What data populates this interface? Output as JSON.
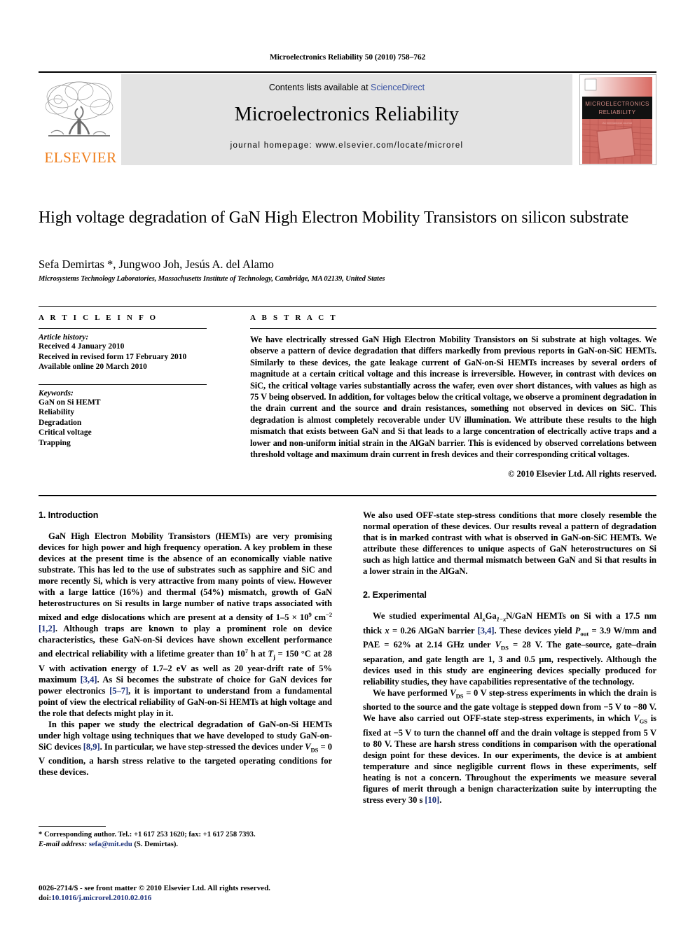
{
  "running_head": "Microelectronics Reliability 50 (2010) 758–762",
  "masthead": {
    "contents_prefix": "Contents lists available at ",
    "sciencedirect": "ScienceDirect",
    "journal_name": "Microelectronics Reliability",
    "homepage": "journal homepage: www.elsevier.com/locate/microrel",
    "publisher_wordmark": "ELSEVIER",
    "cover_title_line1": "MICROELECTRONICS",
    "cover_title_line2": "RELIABILITY",
    "link_color": "#3a53a4",
    "elsevier_orange": "#ef7d1a"
  },
  "article": {
    "title": "High voltage degradation of GaN High Electron Mobility Transistors on silicon substrate",
    "authors": "Sefa Demirtas *, Jungwoo Joh, Jesús A. del Alamo",
    "affiliation": "Microsystems Technology Laboratories, Massachusetts Institute of Technology, Cambridge, MA 02139, United States"
  },
  "article_info": {
    "heading": "A R T I C L E   I N F O",
    "history_label": "Article history:",
    "history": [
      "Received 4 January 2010",
      "Received in revised form 17 February 2010",
      "Available online 20 March 2010"
    ],
    "keywords_label": "Keywords:",
    "keywords": [
      "GaN on Si HEMT",
      "Reliability",
      "Degradation",
      "Critical voltage",
      "Trapping"
    ]
  },
  "abstract": {
    "heading": "A B S T R A C T",
    "text": "We have electrically stressed GaN High Electron Mobility Transistors on Si substrate at high voltages. We observe a pattern of device degradation that differs markedly from previous reports in GaN-on-SiC HEMTs. Similarly to these devices, the gate leakage current of GaN-on-Si HEMTs increases by several orders of magnitude at a certain critical voltage and this increase is irreversible. However, in contrast with devices on SiC, the critical voltage varies substantially across the wafer, even over short distances, with values as high as 75 V being observed. In addition, for voltages below the critical voltage, we observe a prominent degradation in the drain current and the source and drain resistances, something not observed in devices on SiC. This degradation is almost completely recoverable under UV illumination. We attribute these results to the high mismatch that exists between GaN and Si that leads to a large concentration of electrically active traps and a lower and non-uniform initial strain in the AlGaN barrier. This is evidenced by observed correlations between threshold voltage and maximum drain current in fresh devices and their corresponding critical voltages.",
    "copyright": "© 2010 Elsevier Ltd. All rights reserved."
  },
  "sections": {
    "introduction_heading": "1. Introduction",
    "experimental_heading": "2. Experimental"
  },
  "body": {
    "intro_p1_a": "GaN High Electron Mobility Transistors (HEMTs) are very promising devices for high power and high frequency operation. A key problem in these devices at the present time is the absence of an economically viable native substrate. This has led to the use of substrates such as sapphire and SiC and more recently Si, which is very attractive from many points of view. However with a large lattice (16%) and thermal (54%) mismatch, growth of GaN heterostructures on Si results in large number of native traps associated with mixed and edge dislocations which are present at a density of 1–5 × 10",
    "intro_p1_exp1": "9",
    "intro_p1_b": " cm",
    "intro_p1_exp2": "−2",
    "intro_p1_ref1": "[1,2]",
    "intro_p1_c": ". Although traps are known to play a prominent role on device characteristics, these GaN-on-Si devices have shown excellent performance and electrical reliability with a lifetime greater than 10",
    "intro_p1_exp3": "7",
    "intro_p1_d": " h at ",
    "intro_p1_tj": "T",
    "intro_p1_tj_sub": "j",
    "intro_p1_e": " = 150 °C at 28 V with activation energy of 1.7–2 eV as well as 20 year-drift rate of 5% maximum ",
    "intro_p1_ref2": "[3,4]",
    "intro_p1_f": ". As Si becomes the substrate of choice for GaN devices for power electronics ",
    "intro_p1_ref3": "[5–7]",
    "intro_p1_g": ", it is important to understand from a fundamental point of view the electrical reliability of GaN-on-Si HEMTs at high voltage and the role that defects might play in it.",
    "intro_p2_a": "In this paper we study the electrical degradation of GaN-on-Si HEMTs under high voltage using techniques that we have developed to study GaN-on-SiC devices ",
    "intro_p2_ref1": "[8,9]",
    "intro_p2_b": ". In particular, we have step-stressed the devices under ",
    "intro_p2_v": "V",
    "intro_p2_v_sub": "DS",
    "intro_p2_c": " = 0 V condition, a harsh stress relative to the targeted operating conditions for these devices.",
    "right_p1": "We also used OFF-state step-stress conditions that more closely resemble the normal operation of these devices. Our results reveal a pattern of degradation that is in marked contrast with what is observed in GaN-on-SiC HEMTs. We attribute these differences to unique aspects of GaN heterostructures on Si such as high lattice and thermal mismatch between GaN and Si that results in a lower strain in the AlGaN.",
    "exp_p1_a": "We studied experimental Al",
    "exp_p1_sub1": "x",
    "exp_p1_b": "Ga",
    "exp_p1_sub2": "1−x",
    "exp_p1_c": "N/GaN HEMTs on Si with a 17.5 nm thick ",
    "exp_p1_x": "x",
    "exp_p1_d": " = 0.26 AlGaN barrier ",
    "exp_p1_ref1": "[3,4]",
    "exp_p1_e": ". These devices yield ",
    "exp_p1_pout": "P",
    "exp_p1_pout_sub": "out",
    "exp_p1_f": " = 3.9 W/mm and PAE = 62% at 2.14 GHz under ",
    "exp_p1_vds": "V",
    "exp_p1_vds_sub": "DS",
    "exp_p1_g": " = 28 V. The gate–source, gate–drain separation, and gate length are 1, 3 and 0.5 μm, respectively. Although the devices used in this study are engineering devices specially produced for reliability studies, they have capabilities representative of the technology.",
    "exp_p2_a": "We have performed ",
    "exp_p2_vds": "V",
    "exp_p2_vds_sub": "DS",
    "exp_p2_b": " = 0 V step-stress experiments in which the drain is shorted to the source and the gate voltage is stepped down from −5 V to −80 V. We have also carried out OFF-state step-stress experiments, in which ",
    "exp_p2_vgs": "V",
    "exp_p2_vgs_sub": "GS",
    "exp_p2_c": " is fixed at −5 V to turn the channel off and the drain voltage is stepped from 5 V to 80 V. These are harsh stress conditions in comparison with the operational design point for these devices. In our experiments, the device is at ambient temperature and since negligible current flows in these experiments, self heating is not a concern. Throughout the experiments we measure several figures of merit through a benign characterization suite by interrupting the stress every 30 s ",
    "exp_p2_ref1": "[10]",
    "exp_p2_d": "."
  },
  "footnote": {
    "corresponding": "* Corresponding author. Tel.: +1 617 253 1620; fax: +1 617 258 7393.",
    "email_label": "E-mail address:",
    "email": "sefa@mit.edu",
    "email_owner": "(S. Demirtas).",
    "issn_line": "0026-2714/$ - see front matter © 2010 Elsevier Ltd. All rights reserved.",
    "doi_label": "doi:",
    "doi": "10.1016/j.microrel.2010.02.016"
  }
}
